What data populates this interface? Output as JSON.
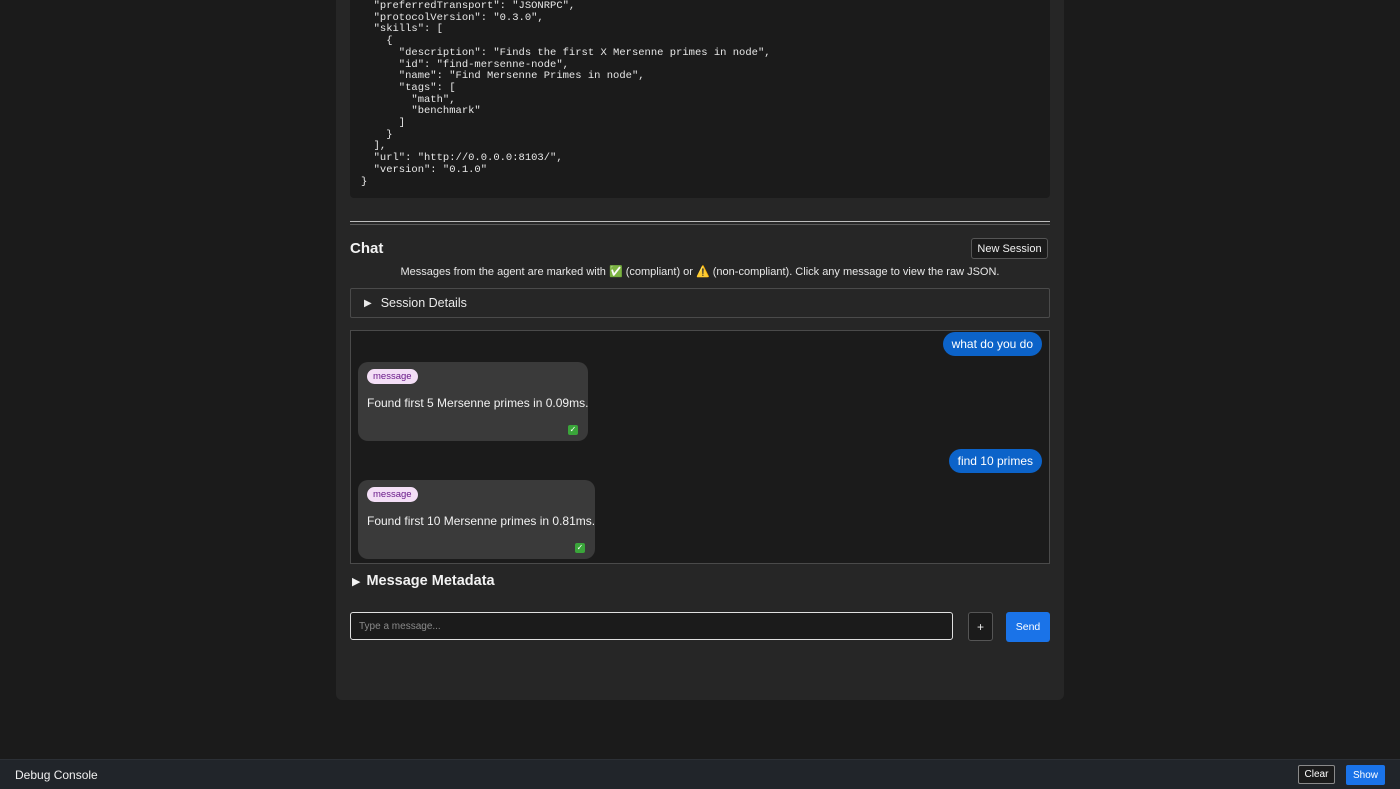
{
  "agent_card_json": "  \"preferredTransport\": \"JSONRPC\",\n  \"protocolVersion\": \"0.3.0\",\n  \"skills\": [\n    {\n      \"description\": \"Finds the first X Mersenne primes in node\",\n      \"id\": \"find-mersenne-node\",\n      \"name\": \"Find Mersenne Primes in node\",\n      \"tags\": [\n        \"math\",\n        \"benchmark\"\n      ]\n    }\n  ],\n  \"url\": \"http://0.0.0.0:8103/\",\n  \"version\": \"0.1.0\"\n}",
  "chat": {
    "title": "Chat",
    "new_session_label": "New Session",
    "note": "Messages from the agent are marked with ✅ (compliant) or ⚠️ (non-compliant). Click any message to view the raw JSON.",
    "session_details_label": "Session Details",
    "messages": [
      {
        "role": "user",
        "text": "what do you do"
      },
      {
        "role": "agent",
        "kind": "message",
        "text": "Found first 5 Mersenne primes in 0.09ms.",
        "status": "compliant"
      },
      {
        "role": "user",
        "text": "find 10 primes"
      },
      {
        "role": "agent",
        "kind": "message",
        "text": "Found first 10 Mersenne primes in 0.81ms.",
        "status": "compliant"
      }
    ],
    "metadata_label": "Message Metadata",
    "input_placeholder": "Type a message...",
    "input_value": "",
    "plus_label": "+",
    "send_label": "Send"
  },
  "debug_console": {
    "title": "Debug Console",
    "clear_label": "Clear",
    "show_label": "Show"
  },
  "colors": {
    "accent": "#1a73e8",
    "user_bubble": "#0c63c9",
    "tag_bg": "#f3def6",
    "compliant": "#3aa53a"
  }
}
